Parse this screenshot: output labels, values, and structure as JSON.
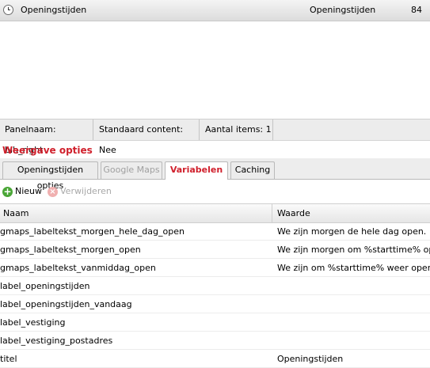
{
  "panel_list": {
    "rows": [
      {
        "name": "Openingstijden",
        "content": "Openingstijden",
        "count": "84"
      }
    ]
  },
  "info_bar": {
    "panel_name": "Panelnaam: blh_right",
    "standard_content": "Standaard content: Nee",
    "item_count": "Aantal items: 1"
  },
  "section": {
    "title": "Weergave opties"
  },
  "tabs": [
    {
      "label": "Openingstijden opties",
      "state": "normal"
    },
    {
      "label": "Google Maps",
      "state": "disabled"
    },
    {
      "label": "Variabelen",
      "state": "active"
    },
    {
      "label": "Caching",
      "state": "normal"
    }
  ],
  "toolbar": {
    "new_label": "Nieuw",
    "delete_label": "Verwijderen"
  },
  "grid": {
    "columns": {
      "name": "Naam",
      "value": "Waarde"
    },
    "rows": [
      {
        "name": "gmaps_labeltekst_morgen_hele_dag_open",
        "value": "We zijn morgen de hele dag open."
      },
      {
        "name": "gmaps_labeltekst_morgen_open",
        "value": "We zijn morgen om %starttime% open."
      },
      {
        "name": "gmaps_labeltekst_vanmiddag_open",
        "value": "We zijn om %starttime% weer open."
      },
      {
        "name": "label_openingstijden",
        "value": ""
      },
      {
        "name": "label_openingstijden_vandaag",
        "value": ""
      },
      {
        "name": "label_vestiging",
        "value": ""
      },
      {
        "name": "label_vestiging_postadres",
        "value": ""
      },
      {
        "name": "titel",
        "value": "Openingstijden"
      }
    ]
  },
  "colors": {
    "accent_red": "#d0202c",
    "new_icon_green": "#4aa636"
  }
}
